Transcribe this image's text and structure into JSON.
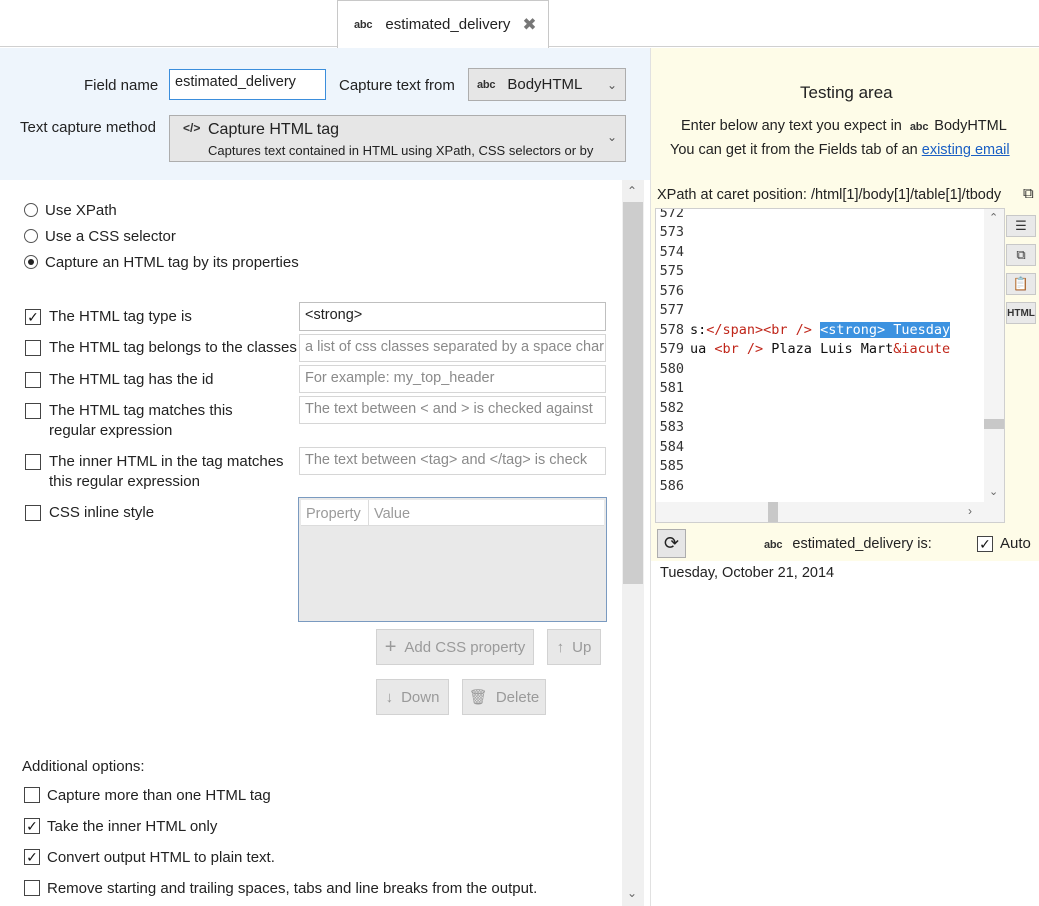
{
  "tab": {
    "icon": "abc",
    "title": "estimated_delivery",
    "close_icon": "close-icon"
  },
  "form": {
    "field_name_label": "Field name",
    "field_name_value": "estimated_delivery",
    "capture_from_label": "Capture text from",
    "capture_from_icon": "abc",
    "capture_from_value": "BodyHTML",
    "method_label": "Text capture method",
    "method_icon": "</>",
    "method_title": "Capture HTML tag",
    "method_desc": "Captures text contained in HTML using XPath, CSS selectors or by"
  },
  "radios": [
    {
      "label": "Use XPath",
      "checked": false
    },
    {
      "label": "Use a CSS selector",
      "checked": false
    },
    {
      "label": "Capture an HTML tag by its properties",
      "checked": true
    }
  ],
  "conditions": [
    {
      "label": "The HTML tag type is",
      "checked": true,
      "value": "<strong>",
      "placeholder": ""
    },
    {
      "label": "The HTML tag belongs to the classes",
      "checked": false,
      "value": "",
      "placeholder": "a list of css classes separated by a space char"
    },
    {
      "label": "The HTML tag has the id",
      "checked": false,
      "value": "",
      "placeholder": "For example: my_top_header"
    },
    {
      "label": "The HTML tag matches this",
      "label2": "regular expression",
      "checked": false,
      "value": "",
      "placeholder": "The text between < and > is checked against"
    },
    {
      "label": "The inner HTML in the tag matches",
      "label2": "this regular expression",
      "checked": false,
      "value": "",
      "placeholder": "The text between <tag> and </tag> is check"
    },
    {
      "label": "CSS inline style",
      "checked": false
    }
  ],
  "css_table": {
    "col_property": "Property",
    "col_value": "Value"
  },
  "buttons": {
    "add_css": "Add CSS property",
    "up": "Up",
    "down": "Down",
    "delete": "Delete"
  },
  "additional": {
    "title": "Additional options:",
    "options": [
      {
        "label": "Capture more than one HTML tag",
        "checked": false
      },
      {
        "label": "Take the inner HTML only",
        "checked": true
      },
      {
        "label": "Convert output HTML to plain text.",
        "checked": true
      },
      {
        "label": "Remove starting and trailing spaces, tabs and line breaks from the output.",
        "checked": false
      }
    ]
  },
  "testing": {
    "title": "Testing area",
    "line1_prefix": "Enter below any text you expect in",
    "line1_icon": "abc",
    "line1_field": "BodyHTML",
    "line2_prefix": "You can get it from the Fields tab of an",
    "line2_link": "existing email",
    "xpath_label": "XPath at caret position:",
    "xpath_value": "/html[1]/body[1]/table[1]/tbody",
    "line_numbers": [
      "572",
      "573",
      "574",
      "575",
      "576",
      "577",
      "578",
      "579",
      "580",
      "581",
      "582",
      "583",
      "584",
      "585",
      "586"
    ],
    "code_578_a": "s:",
    "code_578_tag1": "</span><br />",
    "code_578_sel": "<strong> Tuesday",
    "code_579_a": "ua ",
    "code_579_tag": "<br />",
    "code_579_b": " Plaza Luis Mart",
    "code_579_c": "&iacute",
    "result_icon": "abc",
    "result_label": "estimated_delivery is:",
    "auto_label": "Auto",
    "auto_checked": true,
    "result_value": "Tuesday, October 21, 2014",
    "side_buttons": [
      "menu-icon",
      "copy-icon",
      "paste-icon",
      "HTML"
    ]
  }
}
